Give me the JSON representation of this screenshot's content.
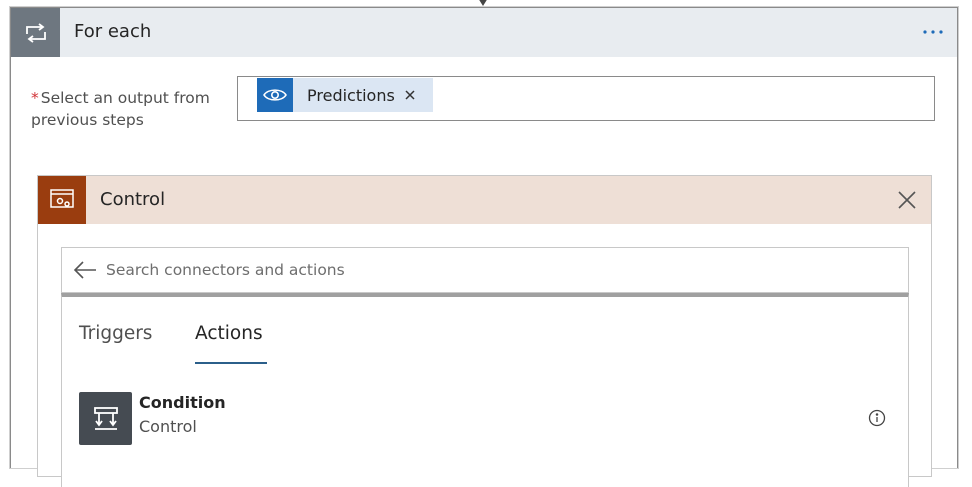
{
  "foreach": {
    "title": "For each",
    "more_icon": "ellipsis-icon",
    "icon": "loop-icon"
  },
  "output_field": {
    "required_mark": "*",
    "label": "Select an output from previous steps",
    "token": {
      "label": "Predictions",
      "icon": "eye-icon",
      "color": "#1e6bb8"
    }
  },
  "control": {
    "title": "Control",
    "icon": "control-icon",
    "accent": "#9a3d0f",
    "search": {
      "placeholder": "Search connectors and actions",
      "value": ""
    },
    "tabs": [
      {
        "label": "Triggers",
        "selected": false
      },
      {
        "label": "Actions",
        "selected": true
      }
    ],
    "actions": [
      {
        "name": "Condition",
        "connector": "Control",
        "icon": "condition-icon"
      }
    ]
  }
}
